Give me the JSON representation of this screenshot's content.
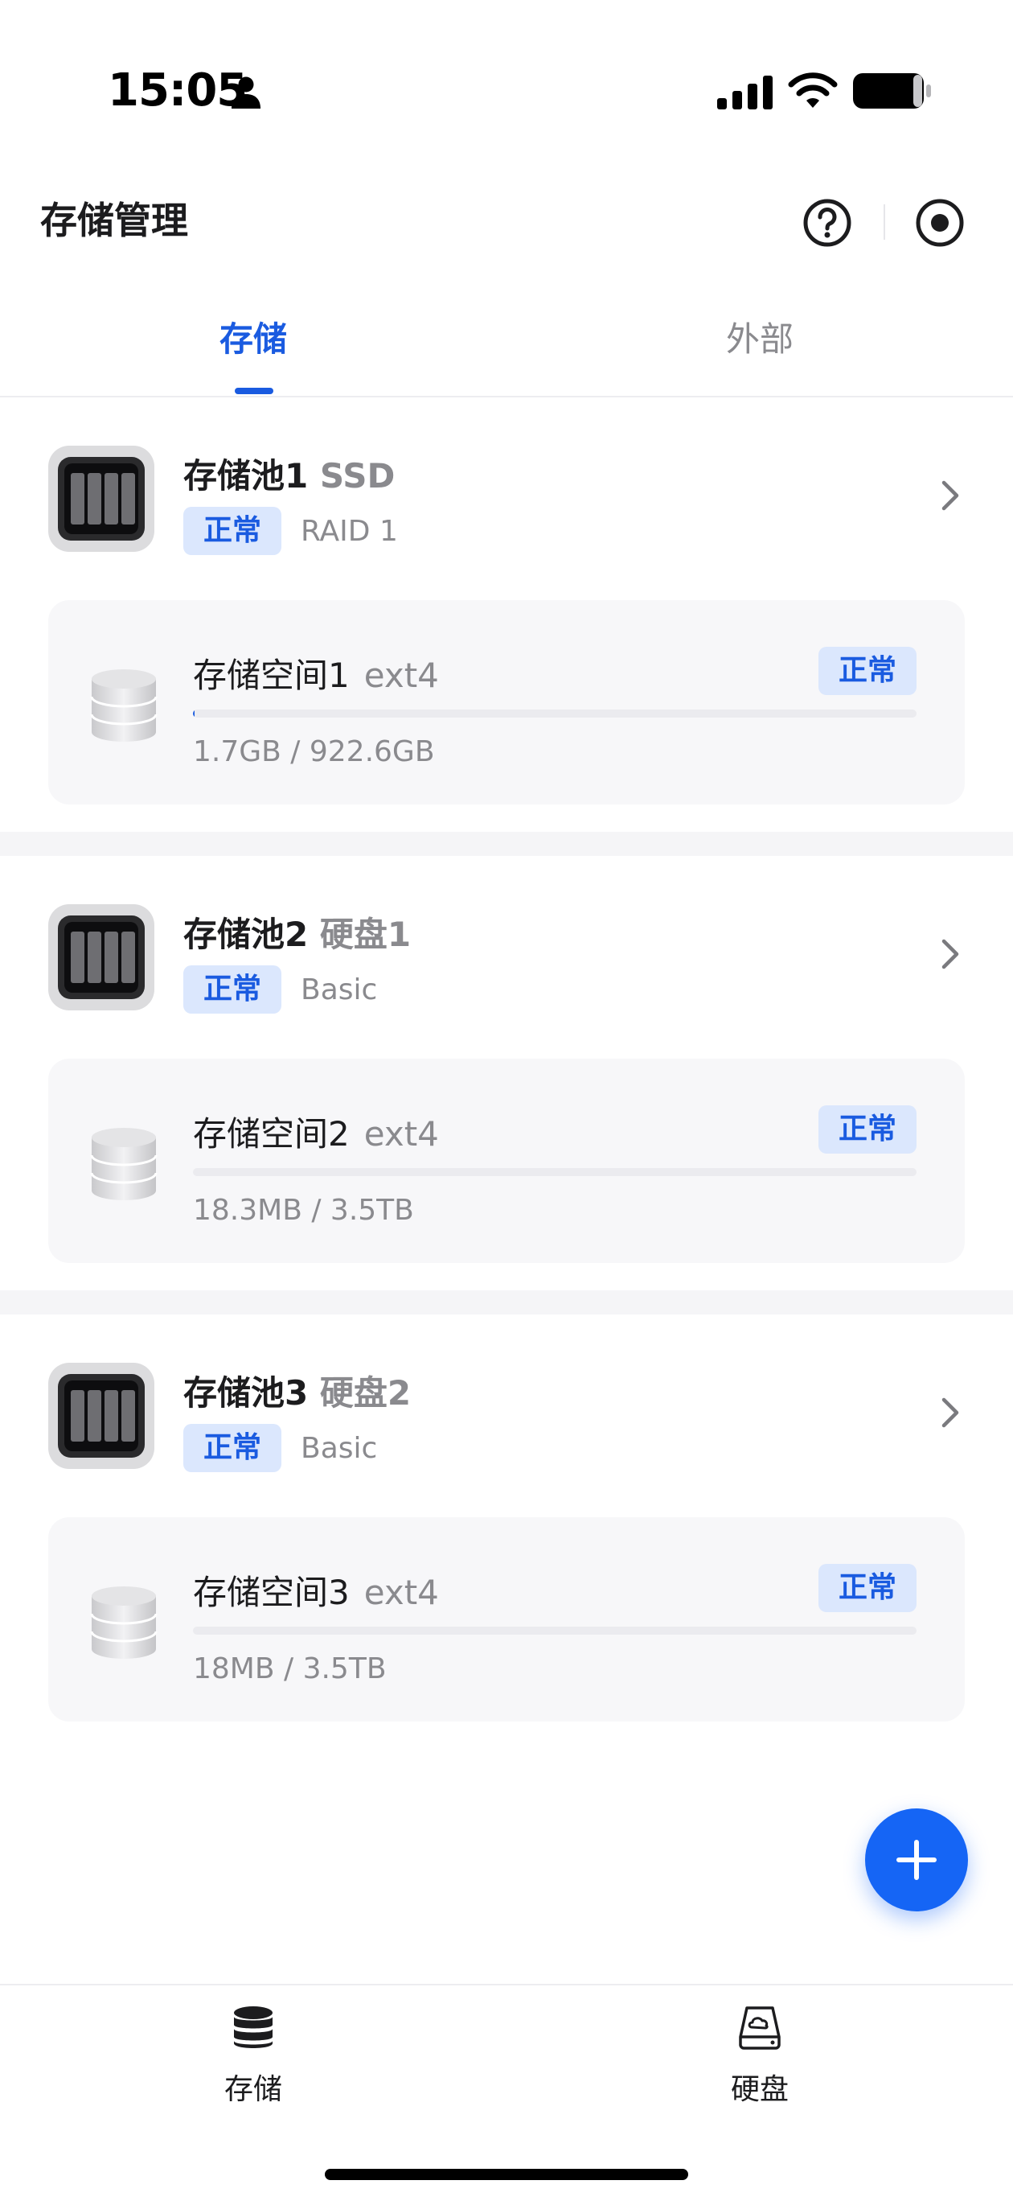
{
  "status_bar": {
    "time": "15:05"
  },
  "header": {
    "title": "存储管理"
  },
  "tabs": [
    {
      "label": "存储",
      "active": true
    },
    {
      "label": "外部",
      "active": false
    }
  ],
  "pools": [
    {
      "name": "存储池1",
      "sub": "SSD",
      "status": "正常",
      "raid": "RAID 1",
      "volume": {
        "name": "存储空间1",
        "fs": "ext4",
        "status": "正常",
        "usage": "1.7GB / 922.6GB",
        "used_fraction": 0.002
      }
    },
    {
      "name": "存储池2",
      "sub": "硬盘1",
      "status": "正常",
      "raid": "Basic",
      "volume": {
        "name": "存储空间2",
        "fs": "ext4",
        "status": "正常",
        "usage": "18.3MB / 3.5TB",
        "used_fraction": 0.0
      }
    },
    {
      "name": "存储池3",
      "sub": "硬盘2",
      "status": "正常",
      "raid": "Basic",
      "volume": {
        "name": "存储空间3",
        "fs": "ext4",
        "status": "正常",
        "usage": "18MB / 3.5TB",
        "used_fraction": 0.0
      }
    }
  ],
  "bottom_nav": [
    {
      "label": "存储",
      "icon": "database-icon"
    },
    {
      "label": "硬盘",
      "icon": "hard-disk-icon"
    }
  ],
  "colors": {
    "accent": "#1a5be0",
    "fab": "#1565f5",
    "badge_bg": "#dbe7fd"
  }
}
